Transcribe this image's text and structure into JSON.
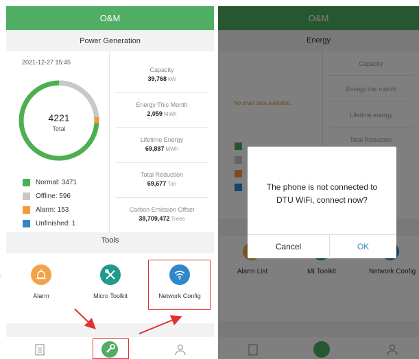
{
  "left": {
    "header": "O&M",
    "power_generation": {
      "title": "Power Generation",
      "timestamp": "2021-12-27 15:45",
      "total_count": "4221",
      "total_label": "Total",
      "stats": [
        {
          "label": "Capacity",
          "value": "39,768",
          "unit": "kW"
        },
        {
          "label": "Energy This Month",
          "value": "2,059",
          "unit": "MWh"
        },
        {
          "label": "Lifetime Energy",
          "value": "69,887",
          "unit": "MWh"
        },
        {
          "label": "Total Reduction",
          "value": "69,677",
          "unit": "Ton"
        },
        {
          "label": "Carbon Emission Offset",
          "value": "38,709,472",
          "unit": "Trees"
        }
      ],
      "legend": [
        {
          "label": "Normal: 3471",
          "color": "#4caf50"
        },
        {
          "label": "Offline: 596",
          "color": "#c8c8c8"
        },
        {
          "label": "Alarm: 153",
          "color": "#f39a3c"
        },
        {
          "label": "Unfinished: 1",
          "color": "#2f87c9"
        }
      ]
    },
    "tools": {
      "title": "Tools",
      "items": [
        {
          "label": "Alarm",
          "icon": "alarm-icon",
          "color": "#f4a24a"
        },
        {
          "label": "Micro Toolkit",
          "icon": "toolkit-icon",
          "color": "#1f9a8c"
        },
        {
          "label": "Network Config",
          "icon": "wifi-icon",
          "color": "#2f87c9"
        }
      ]
    },
    "tabbar": [
      "clipboard-icon",
      "wrench-icon",
      "user-icon"
    ]
  },
  "right": {
    "header": "O&M",
    "energy": {
      "title": "Energy",
      "no_data": "No chart data available.",
      "stat_labels": [
        "Capacity",
        "Energy this month",
        "Lifetime energy",
        "Total Reduction"
      ]
    },
    "tools": [
      "Alarm List",
      "MI Toolkit",
      "Network Config"
    ],
    "dialog": {
      "message_line1": "The phone is not connected to",
      "message_line2": "DTU WiFi, connect now?",
      "cancel": "Cancel",
      "ok": "OK"
    }
  },
  "colors": {
    "accent": "#4fae63",
    "highlight": "#e23131",
    "ok_button": "#2f87c9"
  }
}
